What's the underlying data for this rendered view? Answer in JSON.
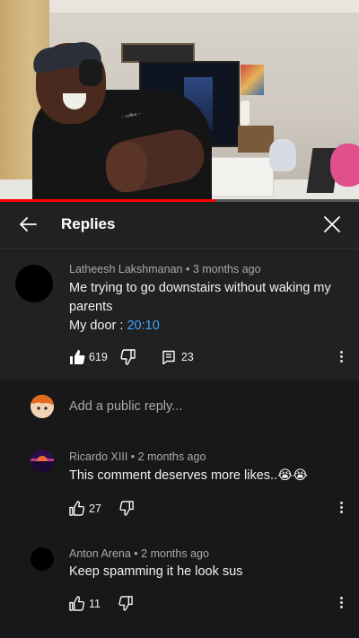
{
  "header": {
    "title": "Replies"
  },
  "video": {
    "progress_fraction": 0.6,
    "shirt_text": "~ coffee ~"
  },
  "top_comment": {
    "author": "Latheesh Lakshmanan",
    "time": "3 months ago",
    "text_line1": "Me trying to go downstairs without waking my",
    "text_line2": "parents",
    "text_line3_prefix": "My door : ",
    "timestamp_link": "20:10",
    "likes": "619",
    "reply_count": "23"
  },
  "reply_input": {
    "placeholder": "Add a public reply..."
  },
  "replies": [
    {
      "author": "Ricardo XIII",
      "time": "2 months ago",
      "text": "This comment deserves more likes..😭😭",
      "likes": "27"
    },
    {
      "author": "Anton Arena",
      "time": "2 months ago",
      "text": "Keep spamming it he look sus",
      "likes": "11"
    }
  ],
  "colors": {
    "background": "#181818",
    "header_bg": "#212121",
    "link": "#3ea6ff",
    "progress": "#ff0000"
  }
}
